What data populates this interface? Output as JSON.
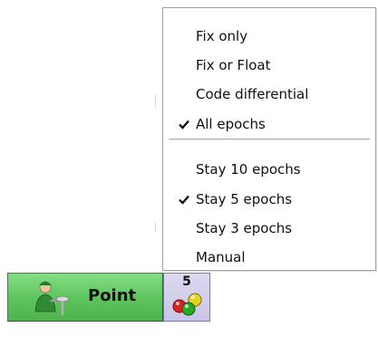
{
  "menu": {
    "items": [
      {
        "label": "Fix only",
        "checked": false
      },
      {
        "label": "Fix or Float",
        "checked": false
      },
      {
        "label": "Code differential",
        "checked": false
      },
      {
        "label": "All epochs",
        "checked": true
      }
    ],
    "items2": [
      {
        "label": "Stay 10 epochs",
        "checked": false
      },
      {
        "label": "Stay 5 epochs",
        "checked": true
      },
      {
        "label": "Stay 3 epochs",
        "checked": false
      },
      {
        "label": "Manual",
        "checked": false
      }
    ]
  },
  "toolbar": {
    "point_label": "Point",
    "point_icon": "surveyor-icon",
    "status_count": "5",
    "status_icon": "traffic-balls-icon"
  },
  "colors": {
    "point_button": "#5cc35b",
    "status_button": "#c9c4e6",
    "ball_red": "#e02020",
    "ball_yellow": "#e8d020",
    "ball_green": "#2aa82a"
  }
}
